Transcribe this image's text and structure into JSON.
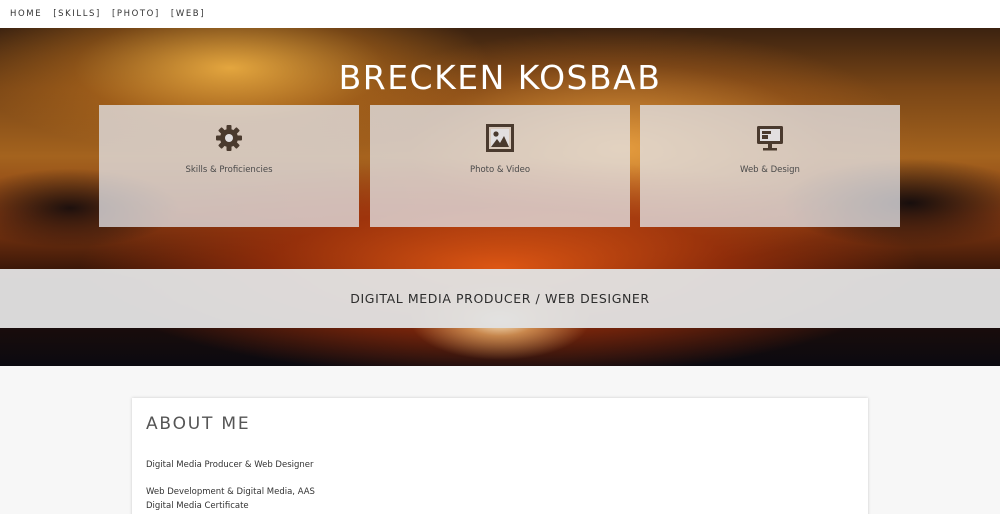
{
  "nav": {
    "items": [
      {
        "label": "HOME"
      },
      {
        "label": "[SKILLS]"
      },
      {
        "label": "[PHOTO]"
      },
      {
        "label": "[WEB]"
      }
    ]
  },
  "hero": {
    "title": "BRECKEN KOSBAB",
    "cards": [
      {
        "label": "Skills & Proficiencies",
        "icon": "gear-icon"
      },
      {
        "label": "Photo & Video",
        "icon": "picture-icon"
      },
      {
        "label": "Web & Design",
        "icon": "monitor-icon"
      }
    ],
    "tagline": "DIGITAL MEDIA PRODUCER / WEB DESIGNER"
  },
  "about": {
    "heading": "ABOUT ME",
    "lines": [
      "Digital Media Producer & Web Designer",
      "Web Development & Digital Media, AAS",
      "Digital Media Certificate"
    ]
  },
  "colors": {
    "icon": "#4a3a2e",
    "band": "#e1e1e1",
    "page_bg": "#f7f7f7"
  }
}
